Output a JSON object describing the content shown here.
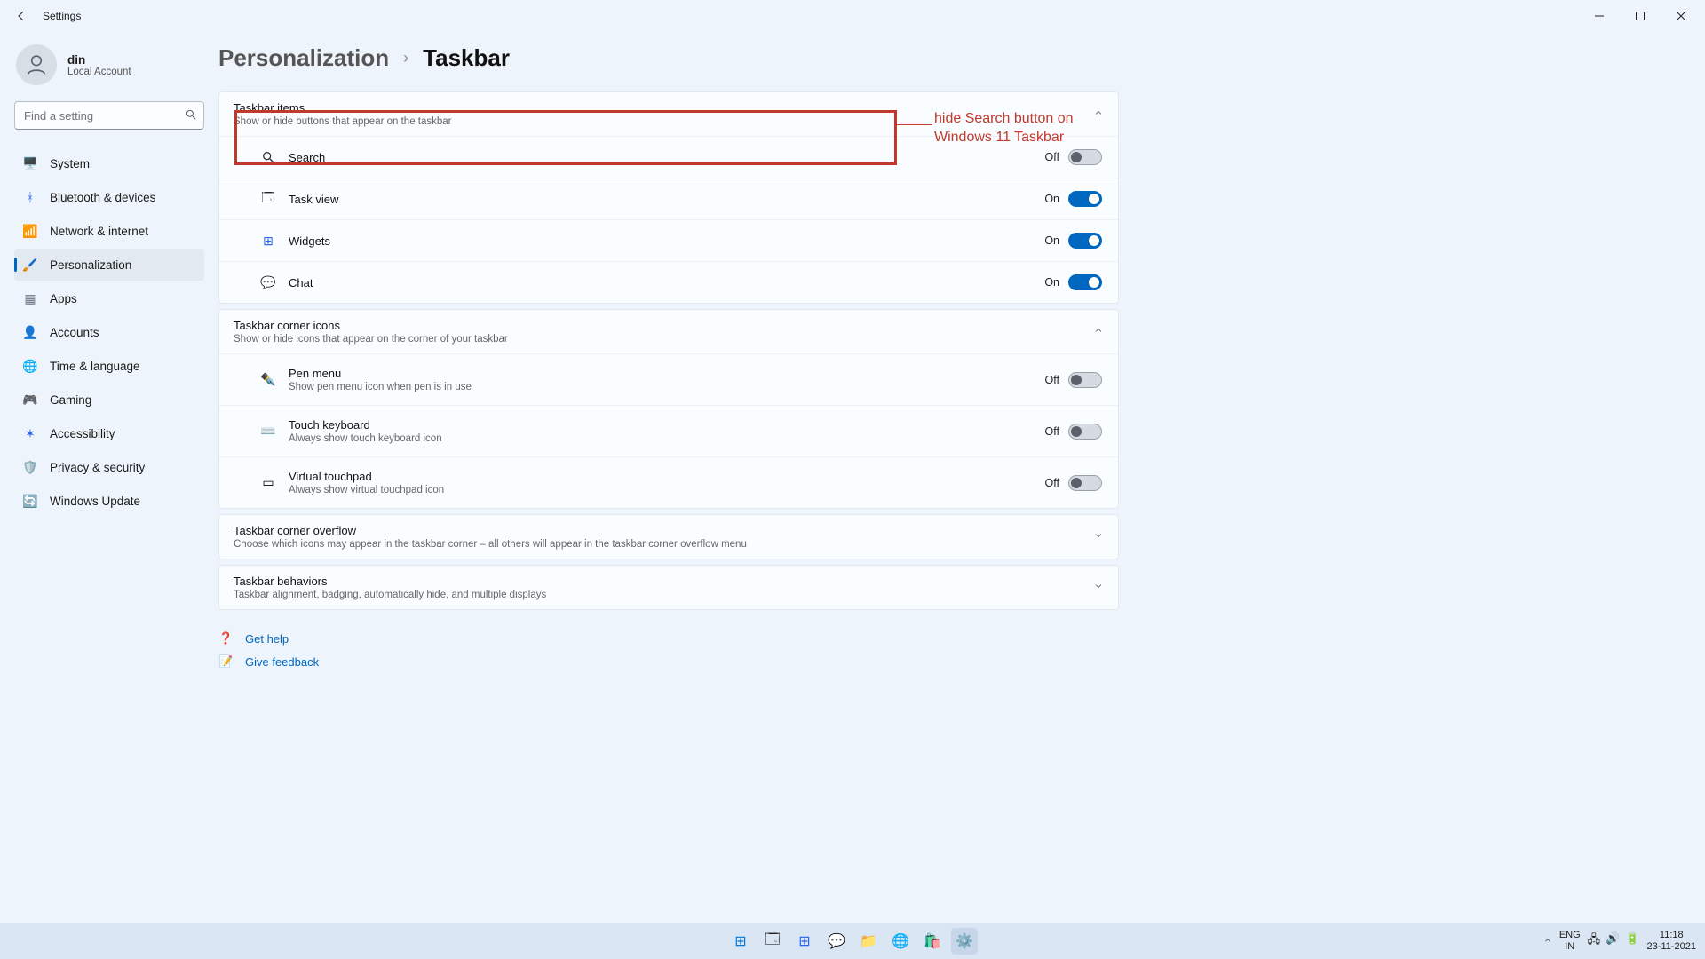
{
  "window": {
    "title": "Settings"
  },
  "user": {
    "name": "din",
    "subtitle": "Local Account"
  },
  "search": {
    "placeholder": "Find a setting"
  },
  "sidebar": {
    "items": [
      {
        "label": "System"
      },
      {
        "label": "Bluetooth & devices"
      },
      {
        "label": "Network & internet"
      },
      {
        "label": "Personalization"
      },
      {
        "label": "Apps"
      },
      {
        "label": "Accounts"
      },
      {
        "label": "Time & language"
      },
      {
        "label": "Gaming"
      },
      {
        "label": "Accessibility"
      },
      {
        "label": "Privacy & security"
      },
      {
        "label": "Windows Update"
      }
    ]
  },
  "breadcrumb": {
    "parent": "Personalization",
    "current": "Taskbar"
  },
  "sections": {
    "taskbar_items": {
      "title": "Taskbar items",
      "subtitle": "Show or hide buttons that appear on the taskbar",
      "rows": [
        {
          "label": "Search",
          "state": "Off"
        },
        {
          "label": "Task view",
          "state": "On"
        },
        {
          "label": "Widgets",
          "state": "On"
        },
        {
          "label": "Chat",
          "state": "On"
        }
      ]
    },
    "corner_icons": {
      "title": "Taskbar corner icons",
      "subtitle": "Show or hide icons that appear on the corner of your taskbar",
      "rows": [
        {
          "label": "Pen menu",
          "sub": "Show pen menu icon when pen is in use",
          "state": "Off"
        },
        {
          "label": "Touch keyboard",
          "sub": "Always show touch keyboard icon",
          "state": "Off"
        },
        {
          "label": "Virtual touchpad",
          "sub": "Always show virtual touchpad icon",
          "state": "Off"
        }
      ]
    },
    "corner_overflow": {
      "title": "Taskbar corner overflow",
      "subtitle": "Choose which icons may appear in the taskbar corner – all others will appear in the taskbar corner overflow menu"
    },
    "behaviors": {
      "title": "Taskbar behaviors",
      "subtitle": "Taskbar alignment, badging, automatically hide, and multiple displays"
    }
  },
  "help": {
    "get_help": "Get help",
    "give_feedback": "Give feedback"
  },
  "annotation": {
    "text": "hide Search button on Windows 11 Taskbar"
  },
  "taskbar": {
    "lang1": "ENG",
    "lang2": "IN",
    "time": "11:18",
    "date": "23-11-2021"
  }
}
